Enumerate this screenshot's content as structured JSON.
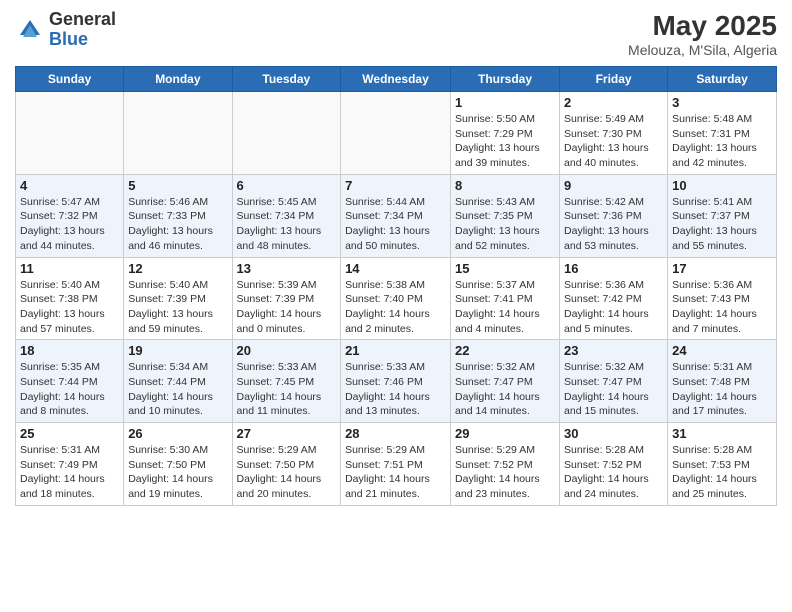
{
  "header": {
    "logo_general": "General",
    "logo_blue": "Blue",
    "main_title": "May 2025",
    "subtitle": "Melouza, M'Sila, Algeria"
  },
  "weekdays": [
    "Sunday",
    "Monday",
    "Tuesday",
    "Wednesday",
    "Thursday",
    "Friday",
    "Saturday"
  ],
  "weeks": [
    [
      {
        "day": "",
        "info": ""
      },
      {
        "day": "",
        "info": ""
      },
      {
        "day": "",
        "info": ""
      },
      {
        "day": "",
        "info": ""
      },
      {
        "day": "1",
        "info": "Sunrise: 5:50 AM\nSunset: 7:29 PM\nDaylight: 13 hours\nand 39 minutes."
      },
      {
        "day": "2",
        "info": "Sunrise: 5:49 AM\nSunset: 7:30 PM\nDaylight: 13 hours\nand 40 minutes."
      },
      {
        "day": "3",
        "info": "Sunrise: 5:48 AM\nSunset: 7:31 PM\nDaylight: 13 hours\nand 42 minutes."
      }
    ],
    [
      {
        "day": "4",
        "info": "Sunrise: 5:47 AM\nSunset: 7:32 PM\nDaylight: 13 hours\nand 44 minutes."
      },
      {
        "day": "5",
        "info": "Sunrise: 5:46 AM\nSunset: 7:33 PM\nDaylight: 13 hours\nand 46 minutes."
      },
      {
        "day": "6",
        "info": "Sunrise: 5:45 AM\nSunset: 7:34 PM\nDaylight: 13 hours\nand 48 minutes."
      },
      {
        "day": "7",
        "info": "Sunrise: 5:44 AM\nSunset: 7:34 PM\nDaylight: 13 hours\nand 50 minutes."
      },
      {
        "day": "8",
        "info": "Sunrise: 5:43 AM\nSunset: 7:35 PM\nDaylight: 13 hours\nand 52 minutes."
      },
      {
        "day": "9",
        "info": "Sunrise: 5:42 AM\nSunset: 7:36 PM\nDaylight: 13 hours\nand 53 minutes."
      },
      {
        "day": "10",
        "info": "Sunrise: 5:41 AM\nSunset: 7:37 PM\nDaylight: 13 hours\nand 55 minutes."
      }
    ],
    [
      {
        "day": "11",
        "info": "Sunrise: 5:40 AM\nSunset: 7:38 PM\nDaylight: 13 hours\nand 57 minutes."
      },
      {
        "day": "12",
        "info": "Sunrise: 5:40 AM\nSunset: 7:39 PM\nDaylight: 13 hours\nand 59 minutes."
      },
      {
        "day": "13",
        "info": "Sunrise: 5:39 AM\nSunset: 7:39 PM\nDaylight: 14 hours\nand 0 minutes."
      },
      {
        "day": "14",
        "info": "Sunrise: 5:38 AM\nSunset: 7:40 PM\nDaylight: 14 hours\nand 2 minutes."
      },
      {
        "day": "15",
        "info": "Sunrise: 5:37 AM\nSunset: 7:41 PM\nDaylight: 14 hours\nand 4 minutes."
      },
      {
        "day": "16",
        "info": "Sunrise: 5:36 AM\nSunset: 7:42 PM\nDaylight: 14 hours\nand 5 minutes."
      },
      {
        "day": "17",
        "info": "Sunrise: 5:36 AM\nSunset: 7:43 PM\nDaylight: 14 hours\nand 7 minutes."
      }
    ],
    [
      {
        "day": "18",
        "info": "Sunrise: 5:35 AM\nSunset: 7:44 PM\nDaylight: 14 hours\nand 8 minutes."
      },
      {
        "day": "19",
        "info": "Sunrise: 5:34 AM\nSunset: 7:44 PM\nDaylight: 14 hours\nand 10 minutes."
      },
      {
        "day": "20",
        "info": "Sunrise: 5:33 AM\nSunset: 7:45 PM\nDaylight: 14 hours\nand 11 minutes."
      },
      {
        "day": "21",
        "info": "Sunrise: 5:33 AM\nSunset: 7:46 PM\nDaylight: 14 hours\nand 13 minutes."
      },
      {
        "day": "22",
        "info": "Sunrise: 5:32 AM\nSunset: 7:47 PM\nDaylight: 14 hours\nand 14 minutes."
      },
      {
        "day": "23",
        "info": "Sunrise: 5:32 AM\nSunset: 7:47 PM\nDaylight: 14 hours\nand 15 minutes."
      },
      {
        "day": "24",
        "info": "Sunrise: 5:31 AM\nSunset: 7:48 PM\nDaylight: 14 hours\nand 17 minutes."
      }
    ],
    [
      {
        "day": "25",
        "info": "Sunrise: 5:31 AM\nSunset: 7:49 PM\nDaylight: 14 hours\nand 18 minutes."
      },
      {
        "day": "26",
        "info": "Sunrise: 5:30 AM\nSunset: 7:50 PM\nDaylight: 14 hours\nand 19 minutes."
      },
      {
        "day": "27",
        "info": "Sunrise: 5:29 AM\nSunset: 7:50 PM\nDaylight: 14 hours\nand 20 minutes."
      },
      {
        "day": "28",
        "info": "Sunrise: 5:29 AM\nSunset: 7:51 PM\nDaylight: 14 hours\nand 21 minutes."
      },
      {
        "day": "29",
        "info": "Sunrise: 5:29 AM\nSunset: 7:52 PM\nDaylight: 14 hours\nand 23 minutes."
      },
      {
        "day": "30",
        "info": "Sunrise: 5:28 AM\nSunset: 7:52 PM\nDaylight: 14 hours\nand 24 minutes."
      },
      {
        "day": "31",
        "info": "Sunrise: 5:28 AM\nSunset: 7:53 PM\nDaylight: 14 hours\nand 25 minutes."
      }
    ]
  ]
}
